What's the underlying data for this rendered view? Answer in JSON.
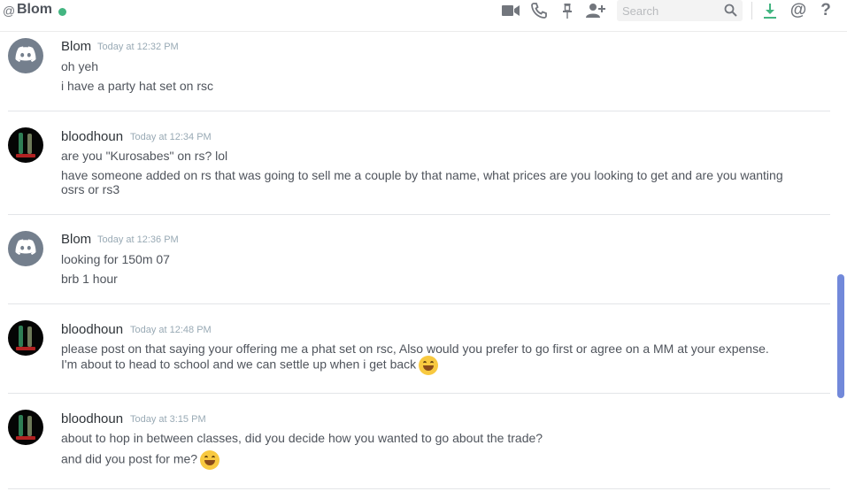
{
  "header": {
    "at_symbol": "@",
    "channel_name": "Blom",
    "status_color": "#43b581",
    "search_placeholder": "Search",
    "icons": [
      "video-call-icon",
      "voice-call-icon",
      "pin-icon",
      "add-friend-icon",
      "search-icon",
      "download-icon",
      "mention-icon",
      "help-icon"
    ],
    "mention_glyph": "@",
    "help_glyph": "?"
  },
  "messages": [
    {
      "author": "Blom",
      "timestamp": "Today at 12:32 PM",
      "avatar": "discord-default-avatar",
      "lines": [
        "oh yeh",
        "i have a party hat set on rsc"
      ]
    },
    {
      "author": "bloodhoun",
      "timestamp": "Today at 12:34 PM",
      "avatar": "bloodhoun-avatar",
      "lines": [
        "are you \"Kurosabes\" on rs? lol",
        "have someone added on rs that was going to sell me a couple by that name, what prices are you looking to get and are you wanting",
        "osrs or rs3"
      ]
    },
    {
      "author": "Blom",
      "timestamp": "Today at 12:36 PM",
      "avatar": "discord-default-avatar",
      "lines": [
        "looking for 150m 07",
        "brb 1 hour"
      ]
    },
    {
      "author": "bloodhoun",
      "timestamp": "Today at 12:48 PM",
      "avatar": "bloodhoun-avatar",
      "lines": [
        "please post on that saying your offering me a phat set on rsc, Also would you prefer to go first or agree on a MM at your expense.",
        "I'm about to head to school and we can settle up when i get back"
      ],
      "emoji": "grinning-smile-emoji"
    },
    {
      "author": "bloodhoun",
      "timestamp": "Today at 3:15 PM",
      "avatar": "bloodhoun-avatar",
      "lines": [
        "about to hop in between classes, did you decide how you wanted to go about the trade?",
        "and did you post for me?"
      ],
      "emoji": "grinning-smile-emoji"
    }
  ],
  "colors": {
    "accent": "#7289da",
    "default_avatar": "#747f8d",
    "username": "#2e3338",
    "timestamp": "#99aab5"
  }
}
